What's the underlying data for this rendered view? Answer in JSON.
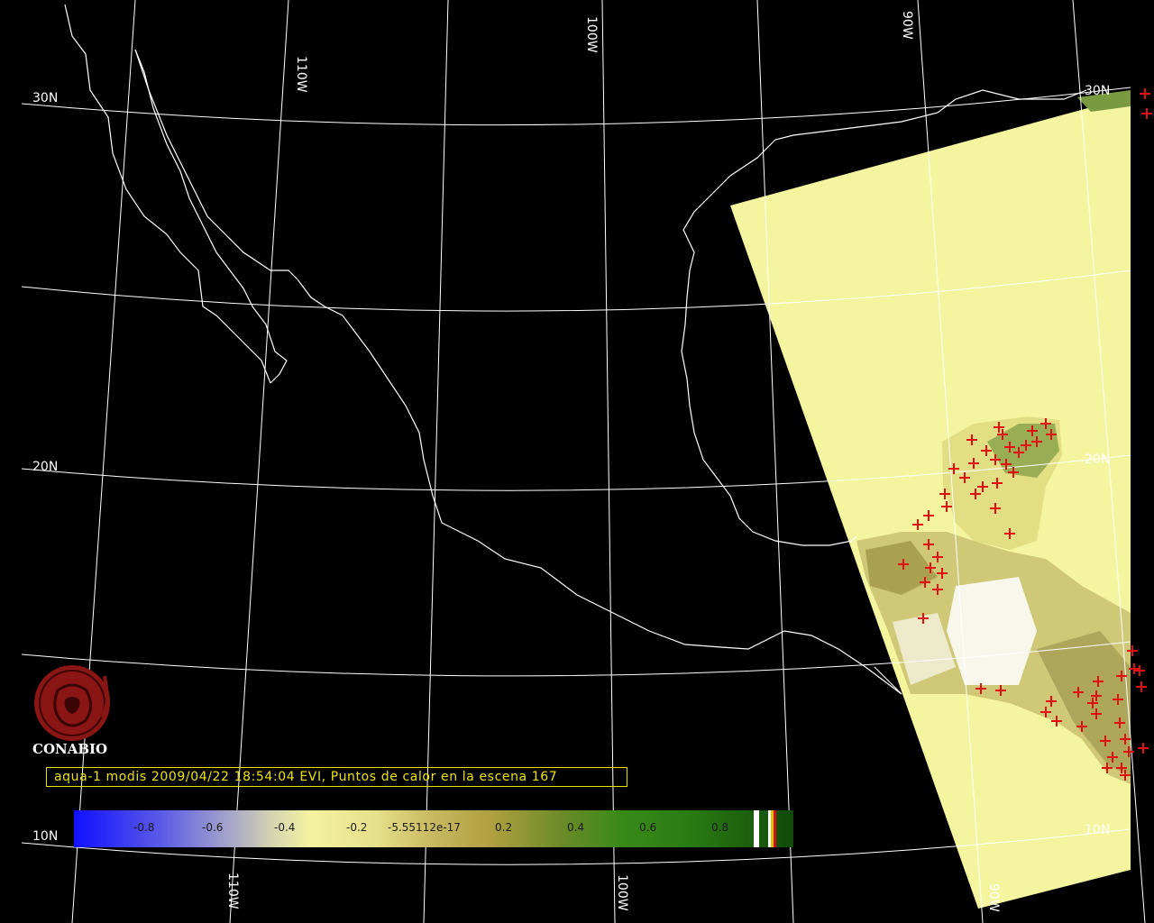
{
  "caption": "aqua-1 modis 2009/04/22 18:54:04 EVI, Puntos de calor en la escena 167",
  "logo_text": "CONABIO",
  "grid_labels": {
    "lat_30n_left": "30N",
    "lat_20n_left": "20N",
    "lat_10n_left": "10N",
    "lat_30n_right": "30N",
    "lat_20n_right": "20N",
    "lat_10n_right": "10N",
    "lon_110w_top": "110W",
    "lon_100w_top": "100W",
    "lon_90w_top": "90W",
    "lon_110w_bottom": "110W",
    "lon_100w_bottom": "100W",
    "lon_90w_bottom": "90W"
  },
  "legend": {
    "ticks": [
      "-0.8",
      "-0.6",
      "-0.4",
      "-0.2",
      "-5.55112e-17",
      "0.2",
      "0.4",
      "0.6",
      "0.8"
    ]
  },
  "colors": {
    "coastline": "#ffffff",
    "graticule": "#ffffff",
    "swath": "#f5f5a0",
    "hotspot": "#e01010",
    "caption": "#ece500"
  },
  "icons": {
    "hotspot": "plus-sign",
    "logo": "conabio-emblem"
  }
}
